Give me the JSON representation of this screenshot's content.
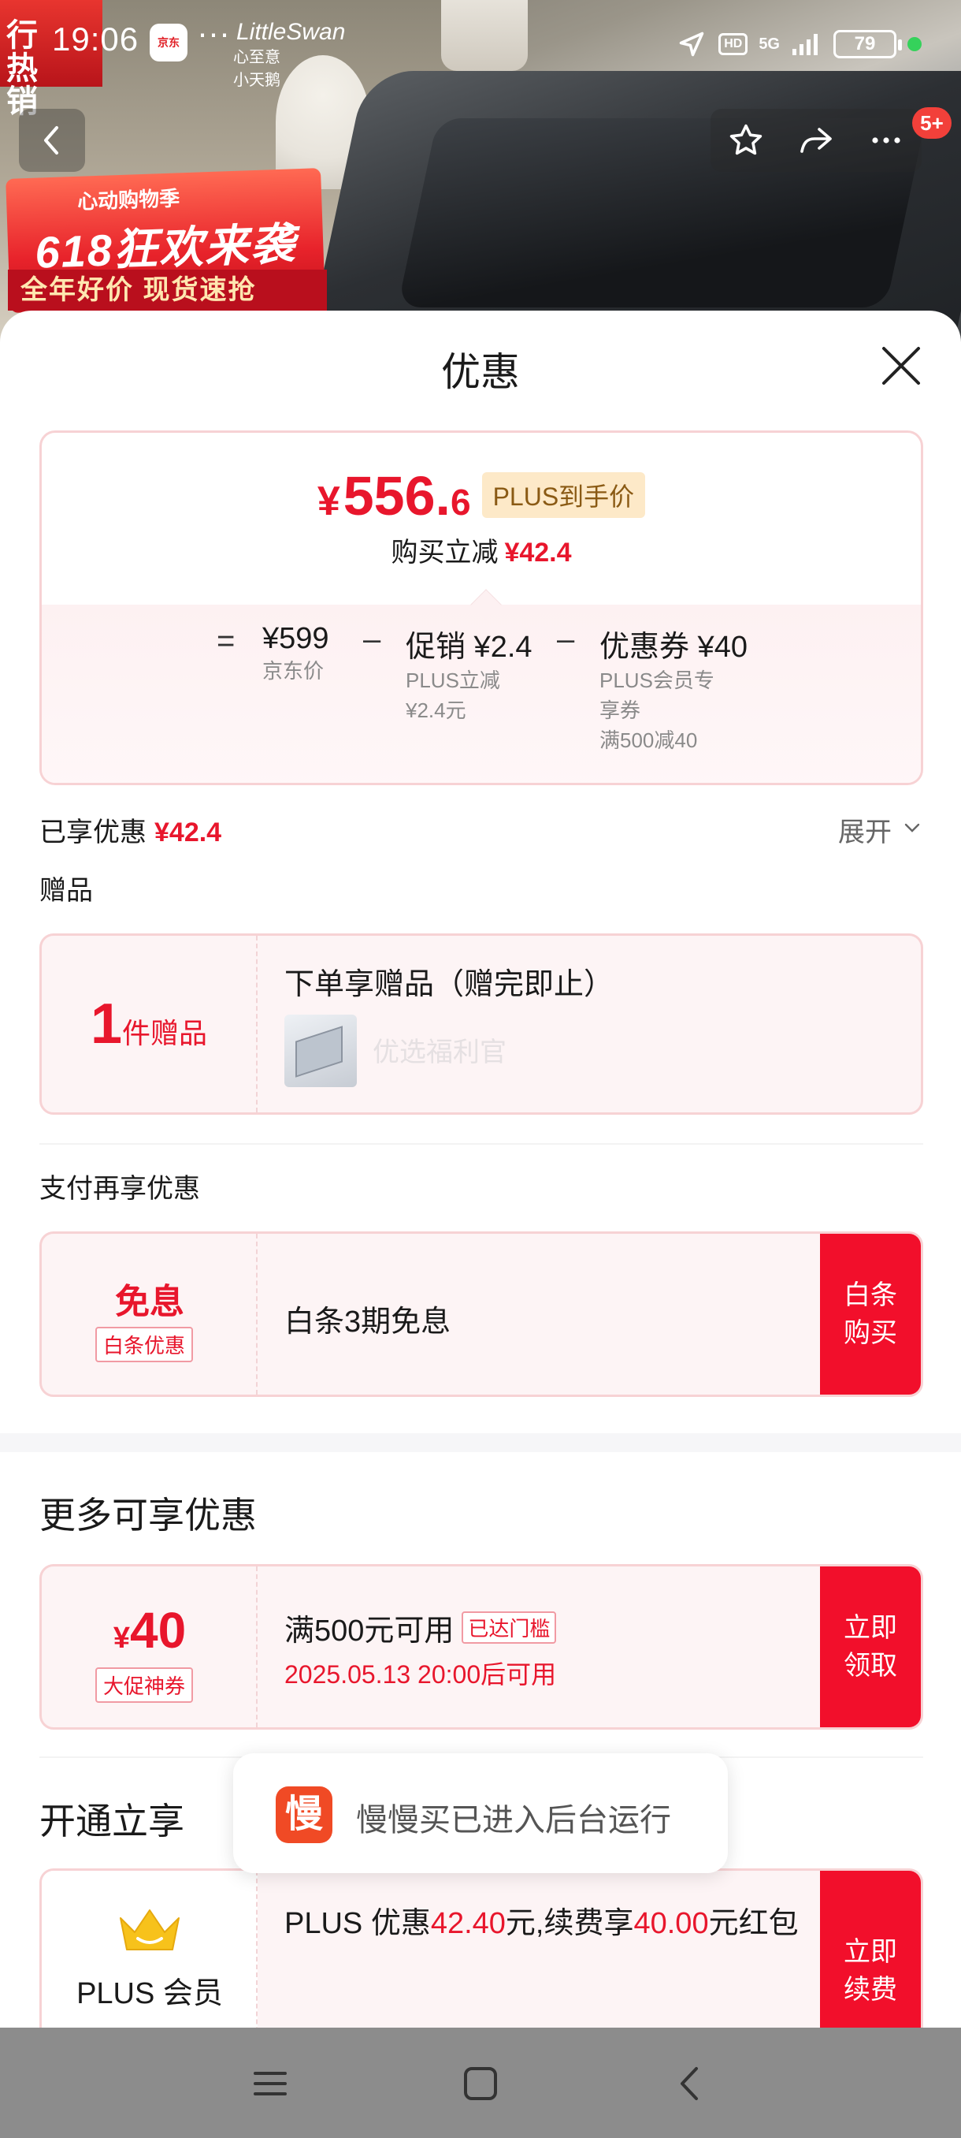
{
  "status_bar": {
    "time": "19:06",
    "app_badge": "京东",
    "more_dots": "···",
    "brand_line1": "LittleSwan",
    "brand_line2": "心至意小天鹅",
    "hd": "HD",
    "network": "5G",
    "battery": "79"
  },
  "backdrop": {
    "ribbon_text": "行热销",
    "promo_small": "心动购物季",
    "promo_big": "618狂欢来袭",
    "promo_sub": "全年好价 现货速抢"
  },
  "header_nav": {
    "cart_badge": "5+",
    "icons": [
      "back-icon",
      "star-icon",
      "share-icon",
      "more-icon"
    ]
  },
  "sheet": {
    "title": "优惠",
    "summary": {
      "price_symbol": "¥",
      "price_int": "556.",
      "price_dec": "6",
      "plus_tag": "PLUS到手价",
      "save_label": "购买立减",
      "save_amount": "¥42.4",
      "equals": "=",
      "minus": "–",
      "jd_price": "¥599",
      "jd_label": "京东价",
      "promo_main": "促销 ¥2.4",
      "promo_sub_1": "PLUS立减",
      "promo_sub_2": "¥2.4元",
      "coupon_main": "优惠券 ¥40",
      "coupon_sub_1": "PLUS会员专",
      "coupon_sub_2": "享券",
      "coupon_sub_3": "满500减40"
    },
    "enjoyed_label": "已享优惠",
    "enjoyed_amount": "¥42.4",
    "expand_label": "展开",
    "gift_section_label": "赠品",
    "gift": {
      "count": "1",
      "unit": "件赠品",
      "title": "下单享赠品（赠完即止）",
      "faded_text": "优选福利官"
    },
    "pay_section_label": "支付再享优惠",
    "pay": {
      "big": "免息",
      "tag": "白条优惠",
      "title": "白条3期免息",
      "button_line1": "白条",
      "button_line2": "购买"
    },
    "more_section_label": "更多可享优惠",
    "coupon": {
      "symbol": "¥",
      "amount": "40",
      "tag": "大促神券",
      "title": "满500元可用",
      "threshold_tag": "已达门槛",
      "date": "2025.05.13 20:00后可用",
      "button_line1": "立即",
      "button_line2": "领取"
    },
    "plus_section_label": "开通立享",
    "plus": {
      "name": "PLUS 会员",
      "text_a": "PLUS 优惠",
      "text_b": "42.40",
      "text_c": "元,续费享",
      "text_d": "40.00",
      "text_e": "元红包",
      "button_line1": "立即",
      "button_line2": "续费"
    }
  },
  "toast": {
    "icon_char": "慢",
    "text": "慢慢买已进入后台运行"
  },
  "colors": {
    "accent_red": "#e8162c",
    "button_red": "#f20f2b",
    "card_border": "#f7d2d4",
    "card_bg": "#fdf4f5",
    "plus_gold": "#8a5a14"
  }
}
